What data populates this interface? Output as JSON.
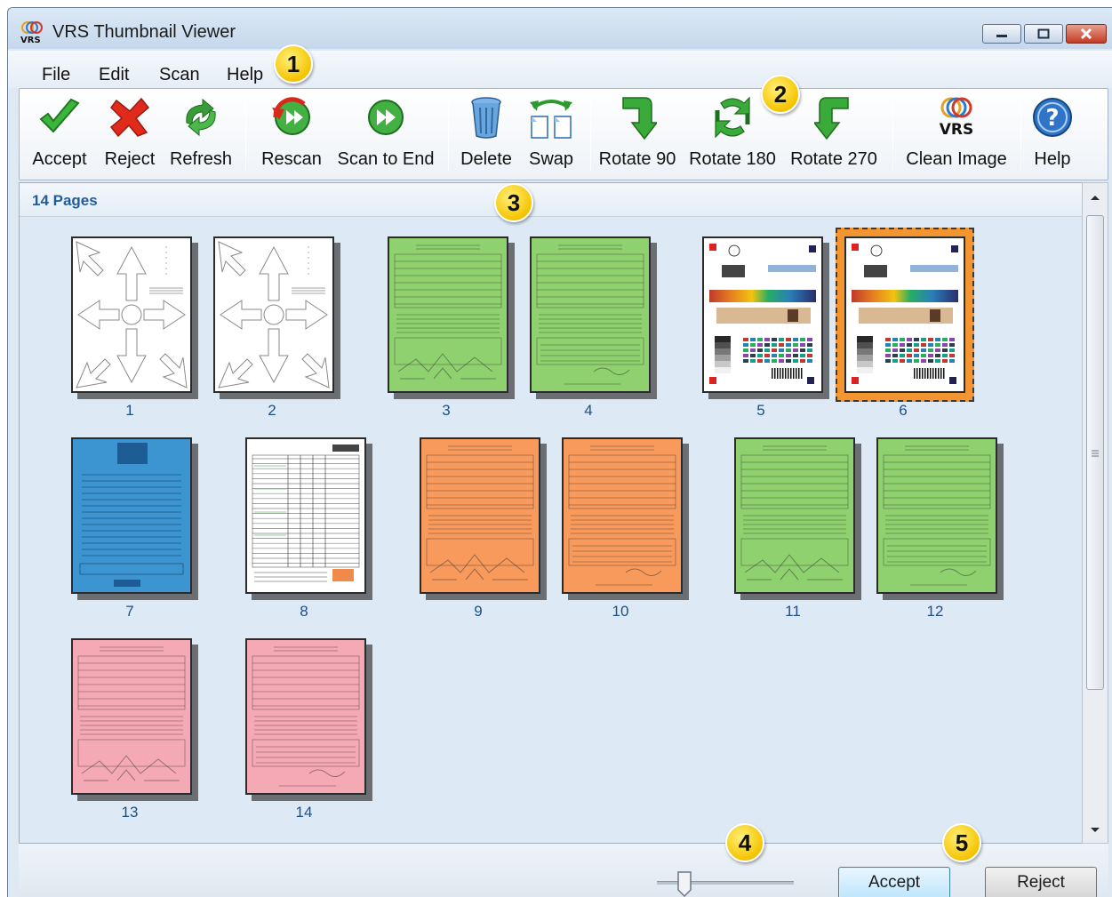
{
  "window": {
    "title": "VRS Thumbnail Viewer",
    "logo_text": "VRS"
  },
  "menu": {
    "items": [
      "File",
      "Edit",
      "Scan",
      "Help"
    ]
  },
  "toolbar": {
    "accept": "Accept",
    "reject": "Reject",
    "refresh": "Refresh",
    "rescan": "Rescan",
    "scan_to_end": "Scan to End",
    "delete": "Delete",
    "swap": "Swap",
    "rotate_90": "Rotate 90",
    "rotate_180": "Rotate 180",
    "rotate_270": "Rotate 270",
    "clean_image": "Clean Image",
    "clean_logo": "VRS",
    "help": "Help"
  },
  "pages": {
    "count_label": "14 Pages",
    "selected": "6",
    "thumbnails": [
      {
        "num": "1",
        "kind": "test-pattern",
        "color": "#ffffff"
      },
      {
        "num": "2",
        "kind": "test-pattern",
        "color": "#ffffff"
      },
      {
        "num": "3",
        "kind": "form-a",
        "color": "#8fd16f"
      },
      {
        "num": "4",
        "kind": "form-b",
        "color": "#8fd16f"
      },
      {
        "num": "5",
        "kind": "color-chart",
        "color": "#ffffff"
      },
      {
        "num": "6",
        "kind": "color-chart",
        "color": "#ffffff"
      },
      {
        "num": "7",
        "kind": "blue-form",
        "color": "#3c95d1"
      },
      {
        "num": "8",
        "kind": "table-form",
        "color": "#ffffff"
      },
      {
        "num": "9",
        "kind": "form-a",
        "color": "#f79a5c"
      },
      {
        "num": "10",
        "kind": "form-b",
        "color": "#f79a5c"
      },
      {
        "num": "11",
        "kind": "form-a",
        "color": "#8fd16f"
      },
      {
        "num": "12",
        "kind": "form-b",
        "color": "#8fd16f"
      },
      {
        "num": "13",
        "kind": "form-a",
        "color": "#f4a9b4"
      },
      {
        "num": "14",
        "kind": "form-b",
        "color": "#f4a9b4"
      }
    ]
  },
  "bottom": {
    "accept": "Accept",
    "reject": "Reject",
    "zoom_slider_fraction": 0.2
  },
  "callouts": [
    "1",
    "2",
    "3",
    "4",
    "5"
  ],
  "colors": {
    "accent_blue": "#1f5d9e",
    "selected_frame": "#f39632",
    "callout_yellow": "#f5c400"
  }
}
